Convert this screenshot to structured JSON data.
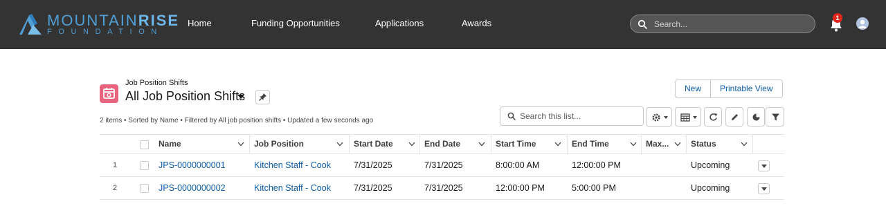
{
  "nav": {
    "logo": {
      "word1": "MOUNTAIN",
      "word2": "RISE",
      "subtitle": "FOUNDATION"
    },
    "links": [
      "Home",
      "Funding Opportunities",
      "Applications",
      "Awards"
    ],
    "search_placeholder": "Search...",
    "notification_count": "1",
    "icons": [
      "search-icon",
      "bell-icon",
      "avatar-icon"
    ]
  },
  "list": {
    "object_label": "Job Position Shifts",
    "title": "All Job Position Shifts",
    "buttons": {
      "new": "New",
      "printable": "Printable View"
    },
    "search_placeholder": "Search this list...",
    "meta": "2 items • Sorted by Name • Filtered by All job position shifts • Updated a few seconds ago",
    "toolbar_icons": [
      "gear-icon",
      "table-view-icon",
      "refresh-icon",
      "edit-icon",
      "chart-icon",
      "filter-icon"
    ]
  },
  "table": {
    "columns": [
      "Name",
      "Job Position",
      "Start Date",
      "End Date",
      "Start Time",
      "End Time",
      "Max...",
      "Status"
    ],
    "rows": [
      {
        "num": "1",
        "name": "JPS-0000000001",
        "job_position": "Kitchen Staff - Cook",
        "start_date": "7/31/2025",
        "end_date": "7/31/2025",
        "start_time": "8:00:00 AM",
        "end_time": "12:00:00 PM",
        "max": "",
        "status": "Upcoming"
      },
      {
        "num": "2",
        "name": "JPS-0000000002",
        "job_position": "Kitchen Staff - Cook",
        "start_date": "7/31/2025",
        "end_date": "7/31/2025",
        "start_time": "12:00:00 PM",
        "end_time": "5:00:00 PM",
        "max": "",
        "status": "Upcoming"
      }
    ]
  },
  "colors": {
    "topbar": "#333333",
    "brand_blue": "#4f9fd6",
    "link": "#0b5cab",
    "object_icon": "#e8637e",
    "badge": "#e0271c"
  }
}
